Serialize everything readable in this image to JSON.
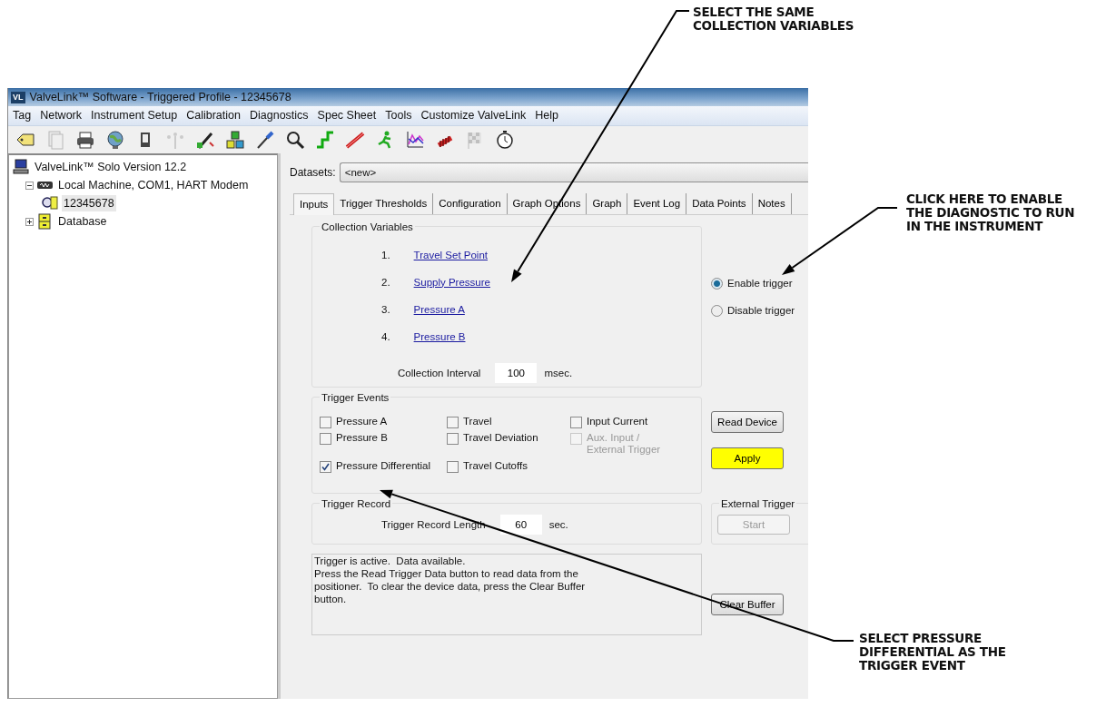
{
  "window": {
    "title": "ValveLink™ Software - Triggered Profile - 12345678",
    "logo": "VL"
  },
  "menu": [
    "Tag",
    "Network",
    "Instrument Setup",
    "Calibration",
    "Diagnostics",
    "Spec Sheet",
    "Tools",
    "Customize ValveLink",
    "Help"
  ],
  "toolbar": [
    {
      "kind": "tag",
      "disabled": false
    },
    {
      "kind": "pages",
      "disabled": true
    },
    {
      "kind": "printer",
      "disabled": false
    },
    {
      "kind": "globe",
      "disabled": false
    },
    {
      "kind": "device",
      "disabled": false
    },
    {
      "kind": "antenna",
      "disabled": true
    },
    {
      "kind": "wand",
      "disabled": false
    },
    {
      "kind": "blocks",
      "disabled": false
    },
    {
      "kind": "screwdriver",
      "disabled": false
    },
    {
      "kind": "magnifier",
      "disabled": false
    },
    {
      "kind": "step",
      "disabled": false
    },
    {
      "kind": "ramp",
      "disabled": false
    },
    {
      "kind": "runner",
      "disabled": false
    },
    {
      "kind": "chart",
      "disabled": false
    },
    {
      "kind": "bars",
      "disabled": false
    },
    {
      "kind": "flag",
      "disabled": true
    },
    {
      "kind": "stopwatch",
      "disabled": false
    }
  ],
  "tree": [
    {
      "label": "ValveLink™ Solo Version 12.2",
      "kind": "computer",
      "selected": false,
      "children": [
        {
          "label": "Local Machine, COM1, HART Modem",
          "kind": "modem",
          "expanded": true,
          "selected": false,
          "children": [
            {
              "label": "12345678",
              "kind": "instrument",
              "selected": true
            }
          ]
        },
        {
          "label": "Database",
          "kind": "cabinet",
          "expanded": false,
          "selected": false
        }
      ]
    }
  ],
  "datasets": {
    "label": "Datasets:",
    "value": "<new>"
  },
  "tabs": [
    {
      "label": "Inputs",
      "selected": true
    },
    {
      "label": "Trigger Thresholds",
      "selected": false
    },
    {
      "label": "Configuration",
      "selected": false
    },
    {
      "label": "Graph Options",
      "selected": false
    },
    {
      "label": "Graph",
      "selected": false
    },
    {
      "label": "Event Log",
      "selected": false
    },
    {
      "label": "Data Points",
      "selected": false
    },
    {
      "label": "Notes",
      "selected": false
    }
  ],
  "collection_variables": {
    "title": "Collection Variables",
    "items": [
      {
        "number": "1.",
        "label": "Travel Set Point"
      },
      {
        "number": "2.",
        "label": "Supply Pressure"
      },
      {
        "number": "3.",
        "label": "Pressure A"
      },
      {
        "number": "4.",
        "label": "Pressure B"
      }
    ],
    "interval_label": "Collection Interval",
    "interval_value": "100",
    "interval_unit": "msec."
  },
  "trigger_mode": [
    {
      "label": "Enable trigger",
      "selected": true
    },
    {
      "label": "Disable trigger",
      "selected": false
    }
  ],
  "trigger_events": {
    "title": "Trigger Events",
    "items": [
      {
        "label": "Pressure A",
        "checked": false,
        "disabled": false
      },
      {
        "label": "Travel",
        "checked": false,
        "disabled": false
      },
      {
        "label": "Input Current",
        "checked": false,
        "disabled": false
      },
      {
        "label": "Pressure B",
        "checked": false,
        "disabled": false
      },
      {
        "label": "Travel Deviation",
        "checked": false,
        "disabled": false
      },
      {
        "label": "Aux. Input /\nExternal Trigger",
        "checked": false,
        "disabled": true
      },
      {
        "label": "Pressure Differential",
        "checked": true,
        "disabled": false
      },
      {
        "label": "Travel Cutoffs",
        "checked": false,
        "disabled": false
      }
    ]
  },
  "device_buttons": [
    {
      "label": "Read Device",
      "highlighted": false
    },
    {
      "label": "Apply",
      "highlighted": true
    }
  ],
  "trigger_record": {
    "title": "Trigger Record",
    "label": "Trigger Record Length",
    "value": "60",
    "unit": "sec."
  },
  "external_trigger": {
    "title": "External Trigger",
    "button": "Start",
    "disabled": true
  },
  "message": "Trigger is active.  Data available.\nPress the Read Trigger Data button to read data from the positioner.  To clear the device data, press the Clear Buffer button.",
  "clear_button": "Clear Buffer",
  "callouts": [
    {
      "text": "SELECT THE SAME\nCOLLECTION VARIABLES"
    },
    {
      "text": "CLICK HERE TO ENABLE\nTHE DIAGNOSTIC TO RUN\nIN THE INSTRUMENT"
    },
    {
      "text": "SELECT PRESSURE\nDIFFERENTIAL AS THE\nTRIGGER EVENT"
    }
  ]
}
